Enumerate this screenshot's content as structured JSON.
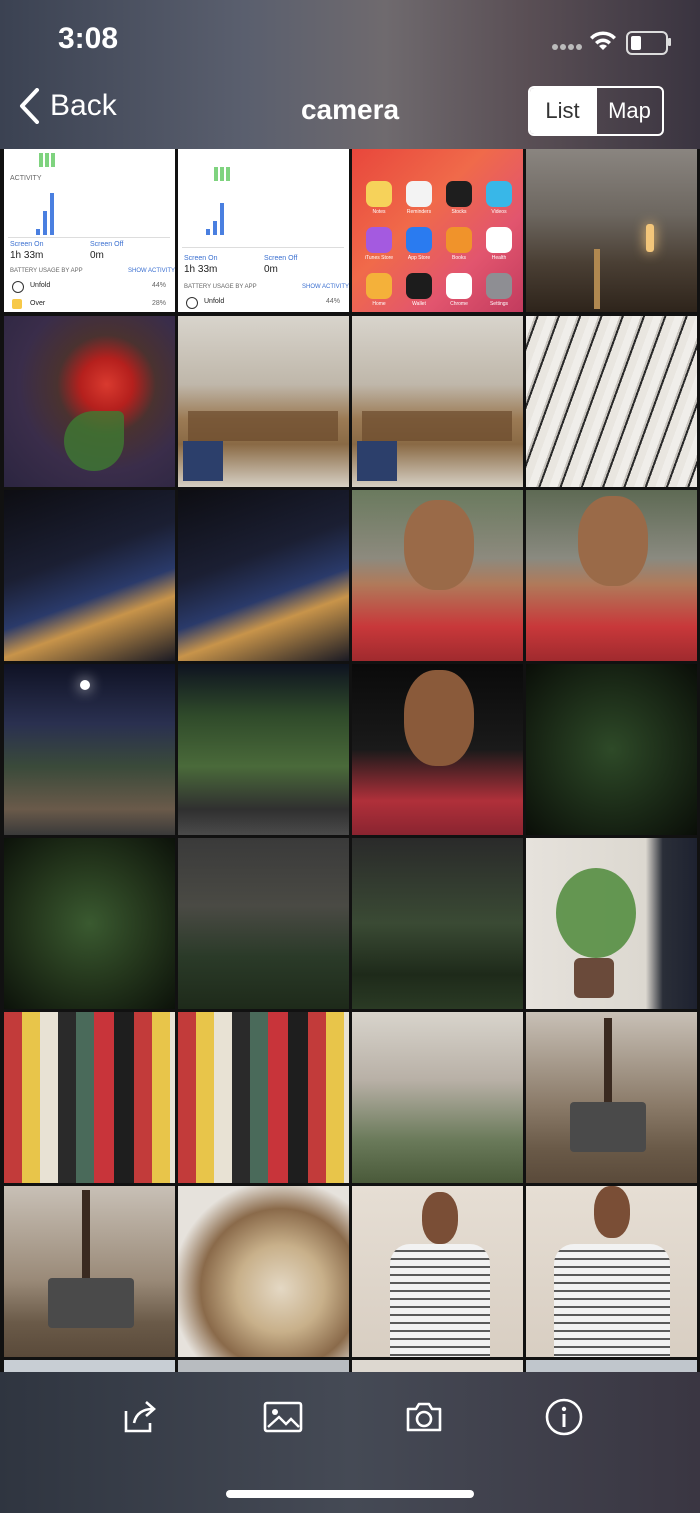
{
  "status_bar": {
    "time": "3:08"
  },
  "nav": {
    "back_label": "Back",
    "title": "camera",
    "segments": [
      "List",
      "Map"
    ],
    "selected_segment": "List"
  },
  "screenshot_tiles": {
    "left": {
      "screen_on_label": "Screen On",
      "screen_on_value": "1h 33m",
      "screen_off_label": "Screen Off",
      "screen_off_value": "0m",
      "usage_heading": "BATTERY USAGE BY APP",
      "activity_link": "SHOW ACTIVITY",
      "rows": [
        {
          "app": "Unfold",
          "pct": "44%"
        },
        {
          "app": "Over",
          "pct": "28%"
        }
      ]
    },
    "right": {
      "screen_on_label": "Screen On",
      "screen_on_value": "1h 33m",
      "screen_off_label": "Screen Off",
      "screen_off_value": "0m",
      "usage_heading": "BATTERY USAGE BY APP",
      "activity_link": "SHOW ACTIVITY",
      "rows": [
        {
          "app": "Unfold",
          "pct": "44%"
        }
      ]
    },
    "home": {
      "apps": [
        "Notes",
        "Reminders",
        "Stocks",
        "Videos",
        "iTunes Store",
        "App Store",
        "Books",
        "Health",
        "Home",
        "Wallet",
        "Chrome",
        "Settings"
      ]
    }
  },
  "toolbar": {
    "icons": [
      "share-icon",
      "photo-icon",
      "camera-icon",
      "info-icon"
    ]
  }
}
